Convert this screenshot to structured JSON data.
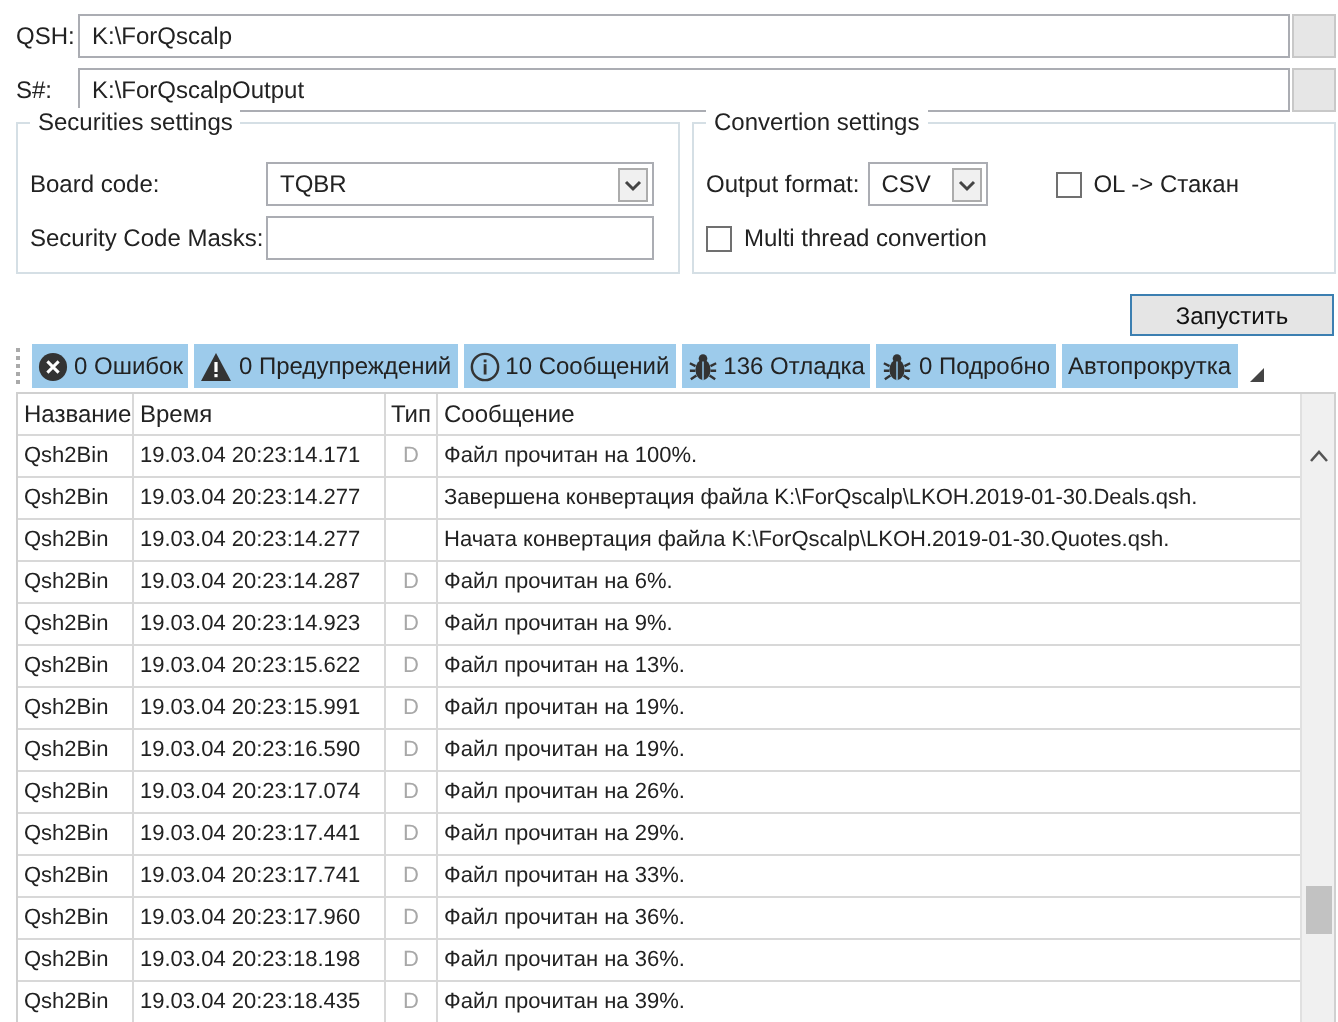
{
  "paths": [
    {
      "label": "QSH:",
      "value": "K:\\ForQscalp"
    },
    {
      "label": "S#:",
      "value": "K:\\ForQscalpOutput"
    }
  ],
  "securities_settings": {
    "title": "Securities settings",
    "board_code_label": "Board code:",
    "board_code": "TQBR",
    "masks_label": "Security Code Masks:"
  },
  "convertion_settings": {
    "title": "Convertion settings",
    "output_format_label": "Output format:",
    "output_format": "CSV",
    "ol_label": "OL -> Стакан",
    "ol_checked": false,
    "multi_label": "Multi thread convertion",
    "multi_checked": false
  },
  "run_button": "Запустить",
  "filters": [
    {
      "kind": "error",
      "label": "0 Ошибок",
      "on": true
    },
    {
      "kind": "warning",
      "label": "0 Предупреждений",
      "on": true
    },
    {
      "kind": "info",
      "label": "10 Сообщений",
      "on": true
    },
    {
      "kind": "debug",
      "label": "136 Отладка",
      "on": true
    },
    {
      "kind": "verbose",
      "label": "0 Подробно",
      "on": true
    },
    {
      "kind": "text",
      "label": "Автопрокрутка",
      "on": true
    }
  ],
  "table": {
    "columns": [
      "Название",
      "Время",
      "Тип",
      "Сообщение"
    ],
    "rows": [
      [
        "Qsh2Bin",
        "19.03.04 20:23:14.171",
        "D",
        "Файл прочитан на 100%."
      ],
      [
        "Qsh2Bin",
        "19.03.04 20:23:14.277",
        "",
        "Завершена конвертация файла K:\\ForQscalp\\LKOH.2019-01-30.Deals.qsh."
      ],
      [
        "Qsh2Bin",
        "19.03.04 20:23:14.277",
        "",
        "Начата конвертация файла K:\\ForQscalp\\LKOH.2019-01-30.Quotes.qsh."
      ],
      [
        "Qsh2Bin",
        "19.03.04 20:23:14.287",
        "D",
        "Файл прочитан на 6%."
      ],
      [
        "Qsh2Bin",
        "19.03.04 20:23:14.923",
        "D",
        "Файл прочитан на 9%."
      ],
      [
        "Qsh2Bin",
        "19.03.04 20:23:15.622",
        "D",
        "Файл прочитан на 13%."
      ],
      [
        "Qsh2Bin",
        "19.03.04 20:23:15.991",
        "D",
        "Файл прочитан на 19%."
      ],
      [
        "Qsh2Bin",
        "19.03.04 20:23:16.590",
        "D",
        "Файл прочитан на 19%."
      ],
      [
        "Qsh2Bin",
        "19.03.04 20:23:17.074",
        "D",
        "Файл прочитан на 26%."
      ],
      [
        "Qsh2Bin",
        "19.03.04 20:23:17.441",
        "D",
        "Файл прочитан на 29%."
      ],
      [
        "Qsh2Bin",
        "19.03.04 20:23:17.741",
        "D",
        "Файл прочитан на 33%."
      ],
      [
        "Qsh2Bin",
        "19.03.04 20:23:17.960",
        "D",
        "Файл прочитан на 36%."
      ],
      [
        "Qsh2Bin",
        "19.03.04 20:23:18.198",
        "D",
        "Файл прочитан на 36%."
      ],
      [
        "Qsh2Bin",
        "19.03.04 20:23:18.435",
        "D",
        "Файл прочитан на 39%."
      ]
    ]
  }
}
